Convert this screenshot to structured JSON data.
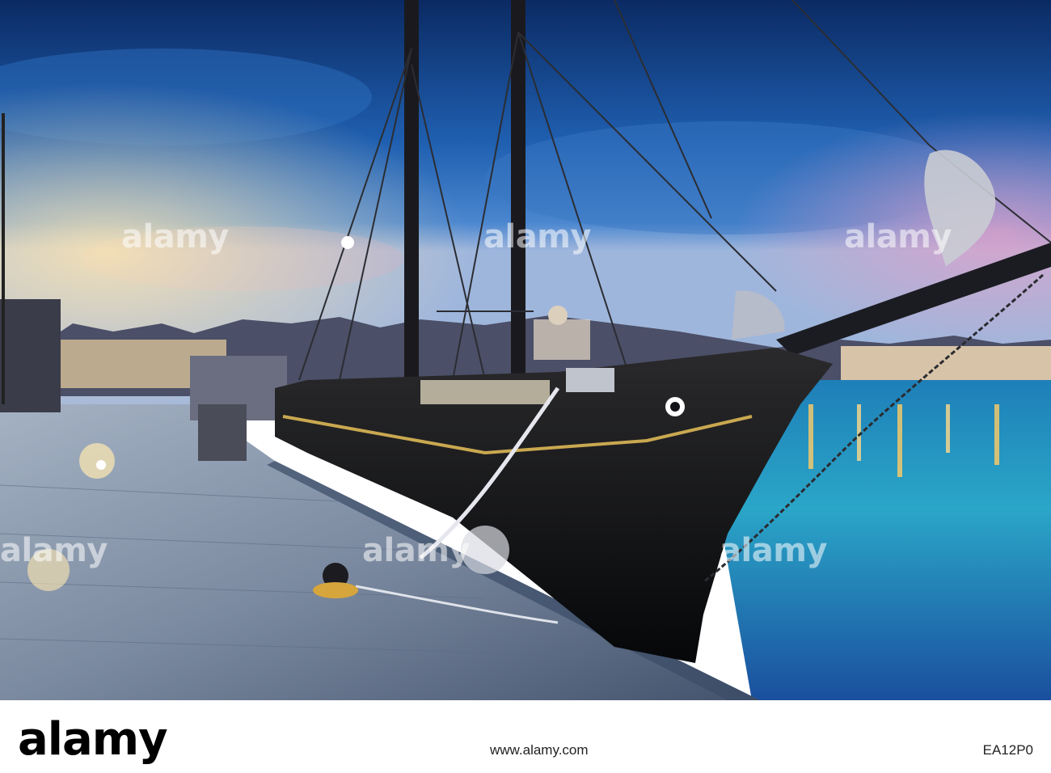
{
  "watermark": "alamy",
  "footer": {
    "logo": "alamy",
    "url": "www.alamy.com",
    "image_id": "EA12P0"
  },
  "colors": {
    "sky_top": "#0b2a63",
    "sky_mid": "#1f5fb0",
    "water": "#2aa6c8",
    "hull": "#111318",
    "lights": "#ffcc66"
  }
}
